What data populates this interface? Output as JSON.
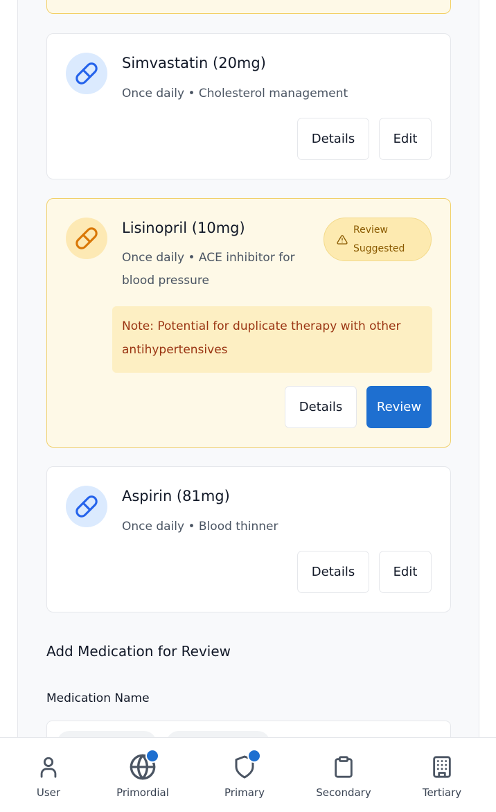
{
  "medications": [
    {
      "name": "Simvastatin (20mg)",
      "detail": "Once daily • Cholesterol management",
      "details_label": "Details",
      "action_label": "Edit"
    },
    {
      "name": "Lisinopril (10mg)",
      "detail_line1": "Once daily • ACE inhibitor for",
      "detail_line2": "blood pressure",
      "badge_line1": "Review",
      "badge_line2": "Suggested",
      "note_line1": "Note: Potential for duplicate therapy with other",
      "note_line2": "antihypertensives",
      "details_label": "Details",
      "action_label": "Review"
    },
    {
      "name": "Aspirin (81mg)",
      "detail": "Once daily • Blood thinner",
      "details_label": "Details",
      "action_label": "Edit"
    }
  ],
  "add_section": {
    "title": "Add Medication for Review",
    "field_label": "Medication Name"
  },
  "nav": [
    {
      "label": "User",
      "icon": "user-icon",
      "badge": false
    },
    {
      "label": "Primordial",
      "icon": "globe-icon",
      "badge": true
    },
    {
      "label": "Primary",
      "icon": "shield-icon",
      "badge": true
    },
    {
      "label": "Secondary",
      "icon": "clipboard-icon",
      "badge": false
    },
    {
      "label": "Tertiary",
      "icon": "building-icon",
      "badge": false
    }
  ],
  "colors": {
    "accent": "#1e6fd0",
    "warning_bg": "#fef9e7",
    "warning_border": "#f1d06a",
    "warning_text": "#9a3412",
    "pill_blue": "#2563eb",
    "pill_orange": "#d97706"
  }
}
